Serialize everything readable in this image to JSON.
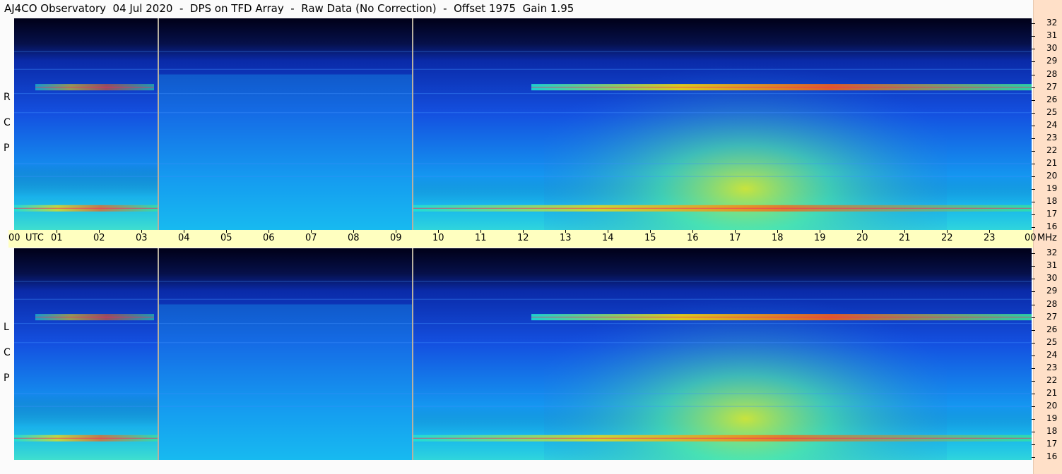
{
  "title": "AJ4CO Observatory  04 Jul 2020  -  DPS on TFD Array  -  Raw Data (No Correction)  -  Offset 1975  Gain 1.95",
  "panels": {
    "top_label": [
      "R",
      "C",
      "P"
    ],
    "bottom_label": [
      "L",
      "C",
      "P"
    ]
  },
  "utc_axis": {
    "start_label": "00",
    "utc_label": "UTC",
    "hour_labels": [
      "01",
      "02",
      "03",
      "04",
      "05",
      "06",
      "07",
      "08",
      "09",
      "10",
      "11",
      "12",
      "13",
      "14",
      "15",
      "16",
      "17",
      "18",
      "19",
      "20",
      "21",
      "22",
      "23"
    ],
    "end_label": "00",
    "mhz_label": "MHz"
  },
  "chart_data": {
    "type": "heatmap",
    "x_axis": {
      "unit": "UTC hour",
      "range": [
        0,
        24
      ],
      "ticks": [
        "00",
        "01",
        "02",
        "03",
        "04",
        "05",
        "06",
        "07",
        "08",
        "09",
        "10",
        "11",
        "12",
        "13",
        "14",
        "15",
        "16",
        "17",
        "18",
        "19",
        "20",
        "21",
        "22",
        "23",
        "00"
      ]
    },
    "y_axis": {
      "unit": "MHz",
      "range": [
        16,
        32
      ],
      "ticks": [
        32,
        31,
        30,
        29,
        28,
        27,
        26,
        25,
        24,
        23,
        22,
        21,
        20,
        19,
        18,
        17,
        16
      ]
    },
    "panels": [
      "RCP",
      "LCP"
    ],
    "vertical_markers_utc": [
      3.4,
      9.4
    ],
    "color_scale": [
      "#000010",
      "#0a1f9a",
      "#1463f0",
      "#12b4f0",
      "#2ee8c8",
      "#c8f030",
      "#ffe000",
      "#ff4000",
      "#c00060"
    ],
    "features": [
      {
        "name": "band ~27 MHz",
        "freq": 27,
        "utc": [
          0.5,
          3.3
        ],
        "level": 0.55
      },
      {
        "name": "band ~27 MHz",
        "freq": 27,
        "utc": [
          12.2,
          24
        ],
        "level": 0.85
      },
      {
        "name": "band ~17-18 MHz",
        "freq": 17.5,
        "utc": [
          0,
          3.4
        ],
        "level": 0.7
      },
      {
        "name": "band ~17-18 MHz",
        "freq": 17.5,
        "utc": [
          9.4,
          24
        ],
        "level": 0.75
      },
      {
        "name": "daytime enhancement",
        "freq": [
          16,
          31
        ],
        "utc": [
          15.5,
          18.5
        ],
        "level": 0.65
      }
    ]
  }
}
